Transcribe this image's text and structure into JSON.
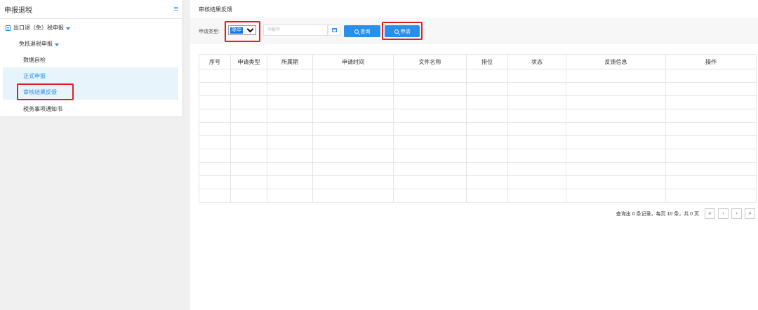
{
  "sidebar": {
    "title": "申报退税",
    "menu_icon": "hamburger-icon",
    "parent": "出口退（免）税申报",
    "sub": "免抵退税申报",
    "items": [
      "数据自检",
      "正式申报",
      "审核结果反馈",
      "税务事项通知书"
    ]
  },
  "main": {
    "title": "审核结果反馈",
    "filter": {
      "type_label": "申请类型:",
      "type_value": "除中",
      "period_placeholder": "申报年",
      "query_label": "查询",
      "apply_label": "申请"
    },
    "table": {
      "headers": [
        "序号",
        "申请类型",
        "所属期",
        "申请时间",
        "文件名称",
        "排位",
        "状态",
        "反馈信息",
        "操作"
      ],
      "empty_rows": 10
    },
    "pagination": {
      "info": "查询出 0 条记录，每页 10 条，共 0 页",
      "buttons": [
        "«",
        "‹",
        "›",
        "»"
      ]
    }
  },
  "colors": {
    "accent": "#2b8ee8",
    "highlight_bg": "#e8f4fc",
    "annotation": "#e02020"
  }
}
